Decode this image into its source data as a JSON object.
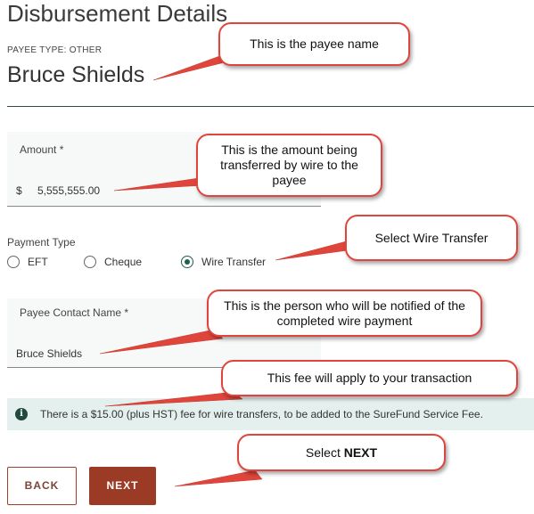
{
  "page": {
    "title": "Disbursement Details",
    "payee_type": "PAYEE TYPE: OTHER",
    "payee_name": "Bruce Shields"
  },
  "amount": {
    "label": "Amount *",
    "prefix": "$",
    "value": "5,555,555.00"
  },
  "payment_type": {
    "label": "Payment Type",
    "options": [
      "EFT",
      "Cheque",
      "Wire Transfer"
    ],
    "selected": "Wire Transfer"
  },
  "contact": {
    "label": "Payee Contact Name *",
    "value": "Bruce Shields"
  },
  "info": {
    "icon": "info-icon",
    "icon_glyph": "i",
    "text": "There is a $15.00 (plus HST) fee for wire transfers, to be added to the SureFund Service Fee."
  },
  "buttons": {
    "back": "BACK",
    "next": "NEXT"
  },
  "callouts": {
    "payee_name": "This is the payee name",
    "amount": "This is the amount being transferred by wire to the payee",
    "wire": "Select Wire Transfer",
    "contact": "This is the person who will be notified of the completed wire payment",
    "fee": "This fee will apply to your transaction",
    "next_prefix": "Select ",
    "next_bold": "NEXT"
  },
  "colors": {
    "accent_green": "#1f5f4f",
    "button_brown": "#9b3a25",
    "callout_border": "#e0453c",
    "info_bg": "#e4f0ed"
  }
}
